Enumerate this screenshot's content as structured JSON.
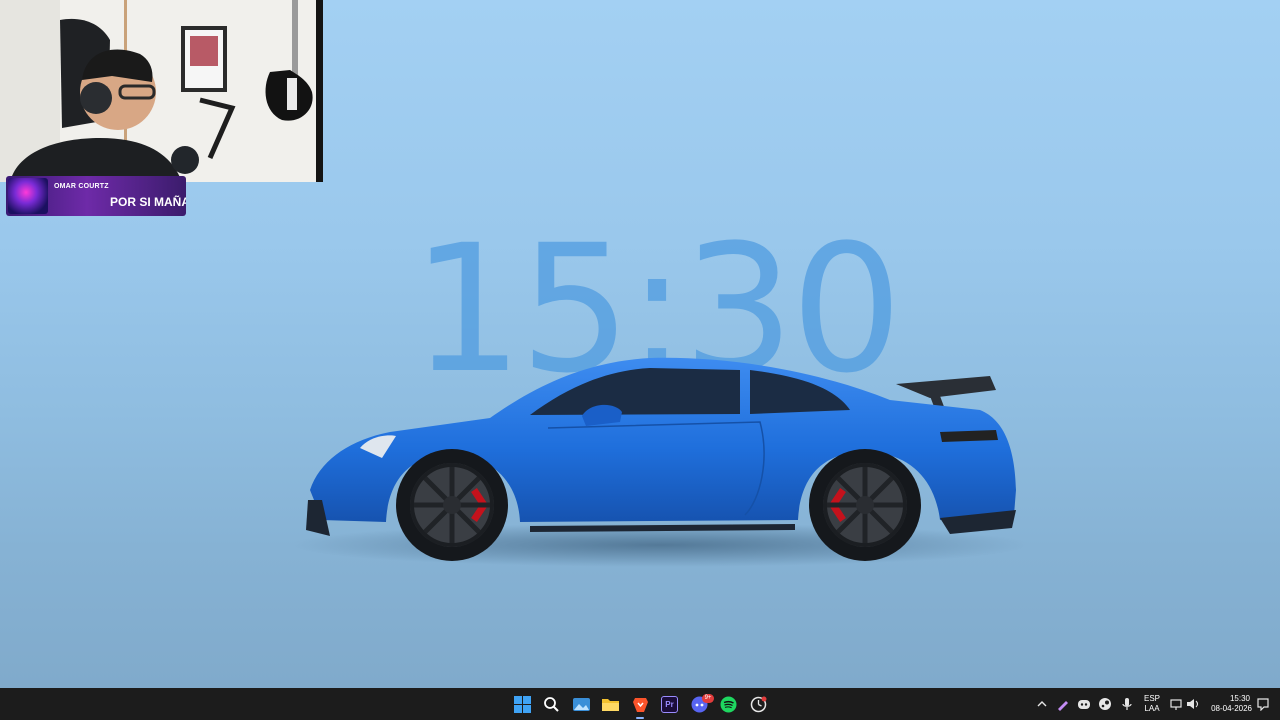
{
  "desktop": {
    "clock_time": "15:30",
    "wallpaper_subject": "blue sports car",
    "accent_color": "#4e9be0"
  },
  "stream_overlay": {
    "streamer_name": "OMAR COURTZ",
    "now_playing": "POR SI MAÑA"
  },
  "taskbar": {
    "pinned_apps": [
      {
        "name": "Start",
        "icon": "windows-start-icon"
      },
      {
        "name": "Search",
        "icon": "search-icon"
      },
      {
        "name": "Photos",
        "icon": "photos-icon"
      },
      {
        "name": "File Explorer",
        "icon": "folder-icon"
      },
      {
        "name": "Brave",
        "icon": "brave-icon"
      },
      {
        "name": "Premiere Pro",
        "icon": "premiere-icon",
        "label": "Pr"
      },
      {
        "name": "Discord",
        "icon": "discord-icon",
        "badge": "9+"
      },
      {
        "name": "Spotify",
        "icon": "spotify-icon"
      },
      {
        "name": "Clock",
        "icon": "clock-app-icon"
      }
    ],
    "tray": {
      "language_top": "ESP",
      "language_bottom": "LAA",
      "time": "15:30",
      "date": "08-04-2026"
    }
  }
}
